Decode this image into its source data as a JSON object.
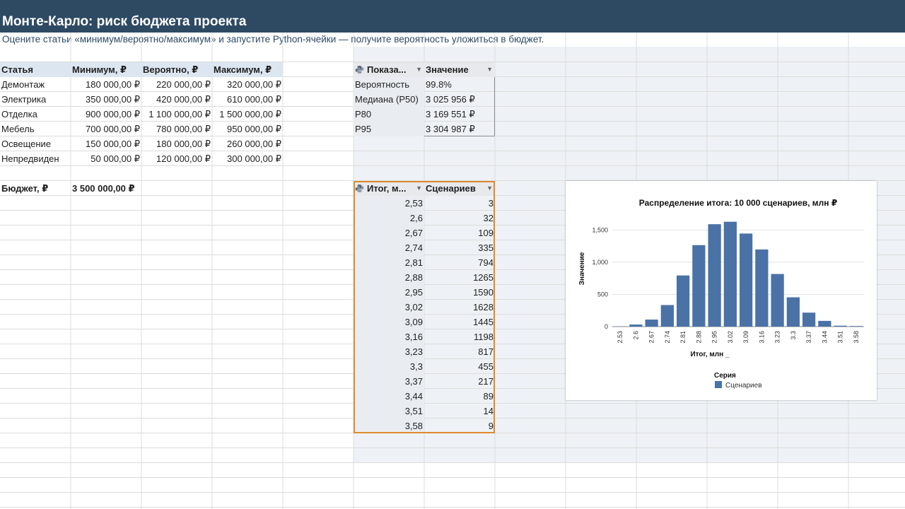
{
  "page": {
    "title": "Монте-Карло: риск бюджета проекта",
    "subtitle": "Оцените статьи «минимум/вероятно/максимум» и запустите Python-ячейки — получите вероятность уложиться в бюджет."
  },
  "items_table": {
    "headers": [
      "Статья",
      "Минимум, ₽",
      "Вероятно, ₽",
      "Максимум, ₽"
    ],
    "rows": [
      [
        "Демонтаж",
        "180 000,00 ₽",
        "220 000,00 ₽",
        "320 000,00 ₽"
      ],
      [
        "Электрика",
        "350 000,00 ₽",
        "420 000,00 ₽",
        "610 000,00 ₽"
      ],
      [
        "Отделка",
        "900 000,00 ₽",
        "1 100 000,00 ₽",
        "1 500 000,00 ₽"
      ],
      [
        "Мебель",
        "700 000,00 ₽",
        "780 000,00 ₽",
        "950 000,00 ₽"
      ],
      [
        "Освещение",
        "150 000,00 ₽",
        "180 000,00 ₽",
        "260 000,00 ₽"
      ],
      [
        "Непредвиден",
        "50 000,00 ₽",
        "120 000,00 ₽",
        "300 000,00 ₽"
      ]
    ]
  },
  "budget": {
    "label": "Бюджет, ₽",
    "value": "3 500 000,00 ₽"
  },
  "stats_table": {
    "headers": [
      "Показа...",
      "Значение"
    ],
    "rows": [
      [
        "Вероятность",
        "99.8%"
      ],
      [
        "Медиана (P50)",
        "3 025 956 ₽"
      ],
      [
        "P80",
        "3 169 551 ₽"
      ],
      [
        "P95",
        "3 304 987 ₽"
      ]
    ]
  },
  "dist_table": {
    "headers": [
      "Итог, м...",
      "Сценариев"
    ],
    "rows": [
      [
        "2,53",
        "3"
      ],
      [
        "2,6",
        "32"
      ],
      [
        "2,67",
        "109"
      ],
      [
        "2,74",
        "335"
      ],
      [
        "2,81",
        "794"
      ],
      [
        "2,88",
        "1265"
      ],
      [
        "2,95",
        "1590"
      ],
      [
        "3,02",
        "1628"
      ],
      [
        "3,09",
        "1445"
      ],
      [
        "3,16",
        "1198"
      ],
      [
        "3,23",
        "817"
      ],
      [
        "3,3",
        "455"
      ],
      [
        "3,37",
        "217"
      ],
      [
        "3,44",
        "89"
      ],
      [
        "3,51",
        "14"
      ],
      [
        "3,58",
        "9"
      ]
    ]
  },
  "chart_data": {
    "type": "bar",
    "title": "Распределение итога: 10 000 сценариев, млн ₽",
    "xlabel": "Итог, млн _",
    "ylabel": "Значение",
    "categories": [
      "2.53",
      "2.6",
      "2.67",
      "2.74",
      "2.81",
      "2.88",
      "2.95",
      "3.02",
      "3.09",
      "3.16",
      "3.23",
      "3.3",
      "3.37",
      "3.44",
      "3.51",
      "3.58"
    ],
    "series": [
      {
        "name": "Сценариев",
        "values": [
          3,
          32,
          109,
          335,
          794,
          1265,
          1590,
          1628,
          1445,
          1198,
          817,
          455,
          217,
          89,
          14,
          9
        ]
      }
    ],
    "yticks": [
      "0",
      "500",
      "1,000",
      "1,500"
    ],
    "ylim": [
      0,
      1800
    ],
    "legend_title": "Серия",
    "legend_position": "bottom-left",
    "grid": true,
    "colors": {
      "bar": "#4a72a6"
    }
  }
}
